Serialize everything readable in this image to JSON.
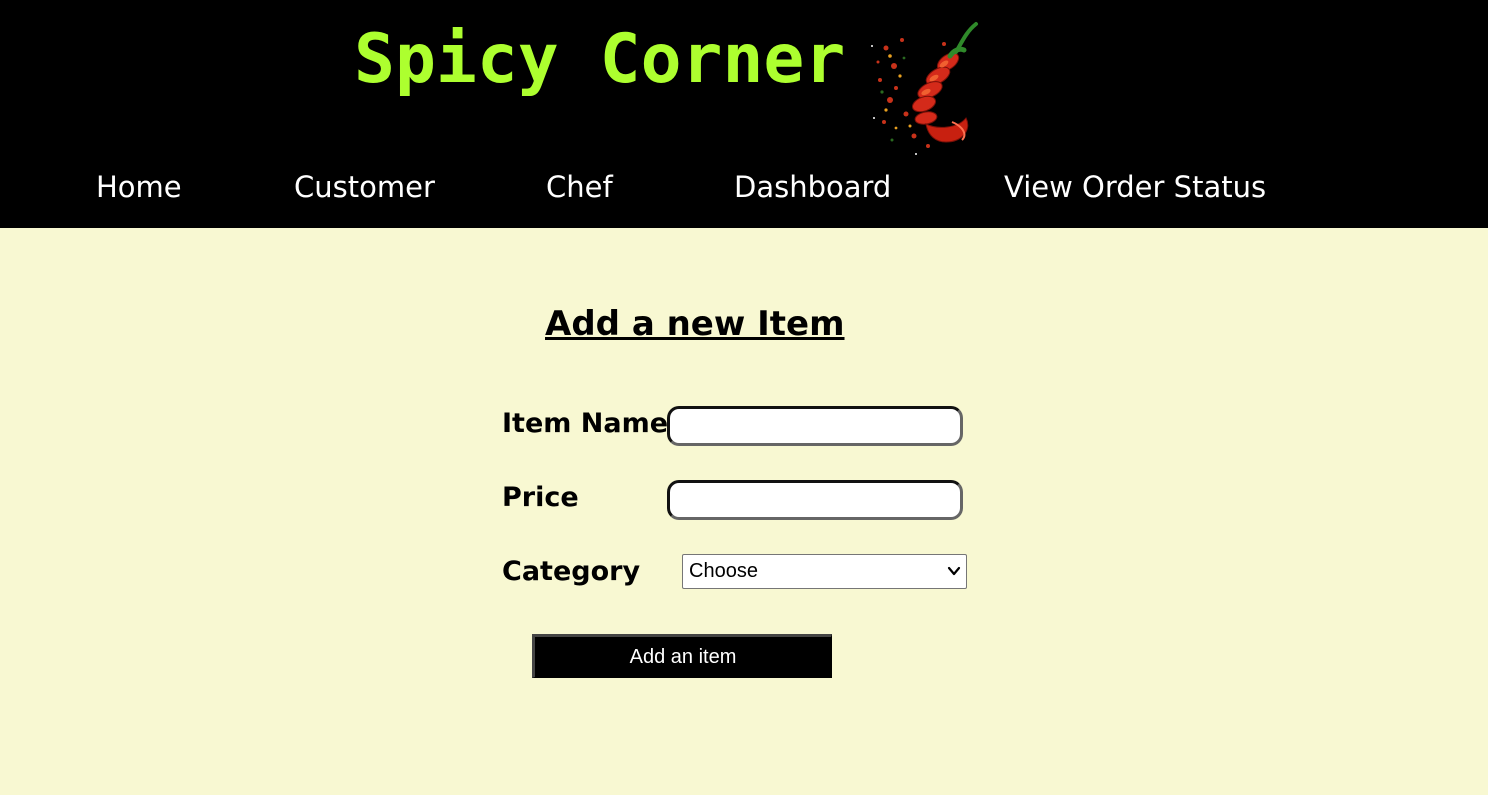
{
  "brand": {
    "title": "Spicy Corner",
    "logo_icon": "chili-pepper-icon",
    "title_color": "#adff2f"
  },
  "nav": {
    "items": [
      {
        "label": "Home"
      },
      {
        "label": "Customer"
      },
      {
        "label": "Chef"
      },
      {
        "label": "Dashboard"
      },
      {
        "label": "View Order Status"
      }
    ]
  },
  "form": {
    "heading": "Add a new Item",
    "item_name": {
      "label": "Item Name",
      "value": ""
    },
    "price": {
      "label": "Price",
      "value": ""
    },
    "category": {
      "label": "Category",
      "selected": "Choose"
    },
    "submit_label": "Add an item"
  },
  "colors": {
    "header_bg": "#000000",
    "page_bg": "#f8f8d2",
    "nav_text": "#ffffff",
    "button_bg": "#000000"
  }
}
